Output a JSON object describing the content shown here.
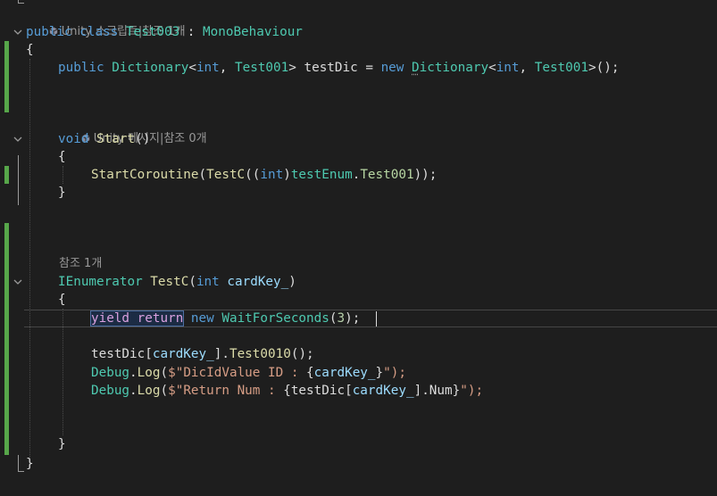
{
  "editor": {
    "codelens": {
      "class_refs": "Unity 스크립트|참조 1개",
      "start_refs": "Unity 메시지|참조 0개",
      "testc_refs": "참조 1개"
    },
    "tokens": {
      "public": "public",
      "class": "class",
      "class_name": "Test003",
      "colon": " : ",
      "base_class": "MonoBehaviour",
      "open_brace": "{",
      "close_brace": "}",
      "dictionary": "Dictionary",
      "lt": "<",
      "gt": ">",
      "int": "int",
      "comma": ", ",
      "test001": "Test001",
      "test_dic": " testDic = ",
      "new": "new",
      "ctor_end": ">();",
      "dict_ctor_first": "D",
      "dict_ctor_rest": "ictionary",
      "void": "void",
      "start": "Start",
      "parens": "()",
      "start_coroutine": "StartCoroutine",
      "paren_open": "(",
      "test_c": "TestC",
      "cast_open": "((",
      "cast_close": ")",
      "test_enum": "testEnum",
      "dot": ".",
      "enum_member": "Test001",
      "call_end": "));",
      "ienumerator": "IEnumerator",
      "card_key": "cardKey_",
      "paren_close": ")",
      "yield": "yield",
      "return": "return",
      "wait_for_seconds": "WaitForSeconds",
      "three": "3",
      "end_stmt": ");",
      "test_dic_name": "testDic",
      "lbracket": "[",
      "rbracket": "]",
      "test0010": "Test0010",
      "empty_call": "();",
      "debug": "Debug",
      "log": "Log",
      "dollar_q": "$\"",
      "dic_id_text": "DicIdValue ID : ",
      "lcurly": "{",
      "rcurly": "}",
      "str_close": "\");",
      "return_num_text": "Return Num : ",
      "num_member": "Num",
      "close_quote_paren": "\");",
      "space": " "
    },
    "colors": {
      "background": "#1e1e1e",
      "keyword": "#569cd6",
      "type": "#4ec9b0",
      "method": "#dcdcaa",
      "parameter": "#9cdcfe",
      "string": "#d69d85",
      "number": "#b5cea8",
      "control_keyword": "#d8a0df",
      "change_bar": "#57a64a"
    }
  }
}
